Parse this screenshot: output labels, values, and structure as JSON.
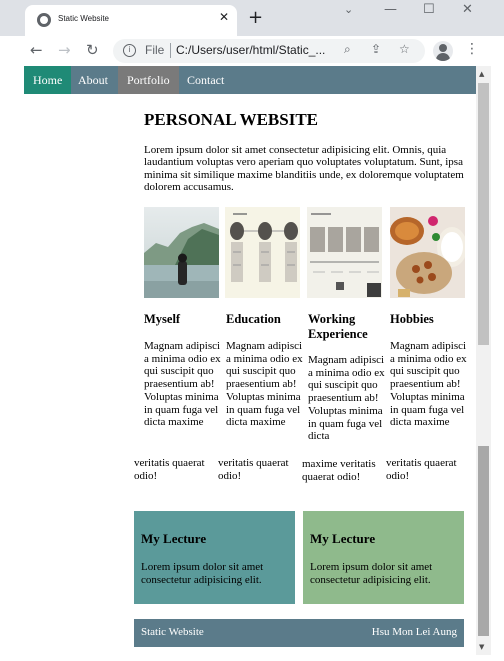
{
  "browser": {
    "tab_title": "Static Website",
    "tab_close": "✕",
    "new_tab": "+",
    "tab_search": "⌄",
    "window": {
      "minimize": "—",
      "maximize": "☐",
      "close": "✕"
    },
    "back": "←",
    "forward": "→",
    "reload": "↻",
    "info": "i",
    "url_prefix": "File",
    "url": "C:/Users/user/html/Static_...",
    "zoom_icon": "⌕",
    "share_icon": "⇪",
    "star_icon": "☆",
    "menu_icon": "⋮"
  },
  "nav": {
    "items": [
      {
        "label": "Home"
      },
      {
        "label": "About"
      },
      {
        "label": "Portfolio"
      },
      {
        "label": "Contact"
      }
    ]
  },
  "page": {
    "title": "PERSONAL WEBSITE",
    "intro": "Lorem ipsum dolor sit amet consectetur adipisicing elit. Omnis, quia laudantium voluptas vero aperiam quo voluptates voluptatum. Sunt, ipsa minima sit similique maxime blanditiis unde, ex doloremque voluptatem dolorem accusamus."
  },
  "columns": [
    {
      "heading": "Myself",
      "text_wrapped": "Magnam adipisci a minima odio ex qui suscipit quo praesentium ab! Voluptas minima in quam fuga vel dicta maxime",
      "text_tail": "veritatis quaerat odio!"
    },
    {
      "heading": "Education",
      "text_wrapped": "Magnam adipisci a minima odio ex qui suscipit quo praesentium ab! Voluptas minima in quam fuga vel dicta maxime",
      "text_tail": "veritatis quaerat odio!"
    },
    {
      "heading": "Working Experience",
      "text_wrapped": "Magnam adipisci a minima odio ex qui suscipit quo praesentium ab! Voluptas minima in quam fuga vel dicta",
      "text_tail": "maxime veritatis quaerat odio!"
    },
    {
      "heading": "Hobbies",
      "text_wrapped": "Magnam adipisci a minima odio ex qui suscipit quo praesentium ab! Voluptas minima in quam fuga vel dicta maxime",
      "text_tail": "veritatis quaerat odio!"
    }
  ],
  "lectures": [
    {
      "title": "My Lecture",
      "text": "Lorem ipsum dolor sit amet consectetur adipisicing elit.",
      "color": "#5b9a9a"
    },
    {
      "title": "My Lecture",
      "text": "Lorem ipsum dolor sit amet consectetur adipisicing elit.",
      "color": "#8fba8c"
    }
  ],
  "footer": {
    "left": "Static Website",
    "right": "Hsu Mon Lei Aung"
  },
  "colors": {
    "nav_bg": "#5b7b8a",
    "nav_active": "#1f8a76",
    "nav_hover": "#7a7a7a",
    "footer_bg": "#5b7b8a"
  }
}
